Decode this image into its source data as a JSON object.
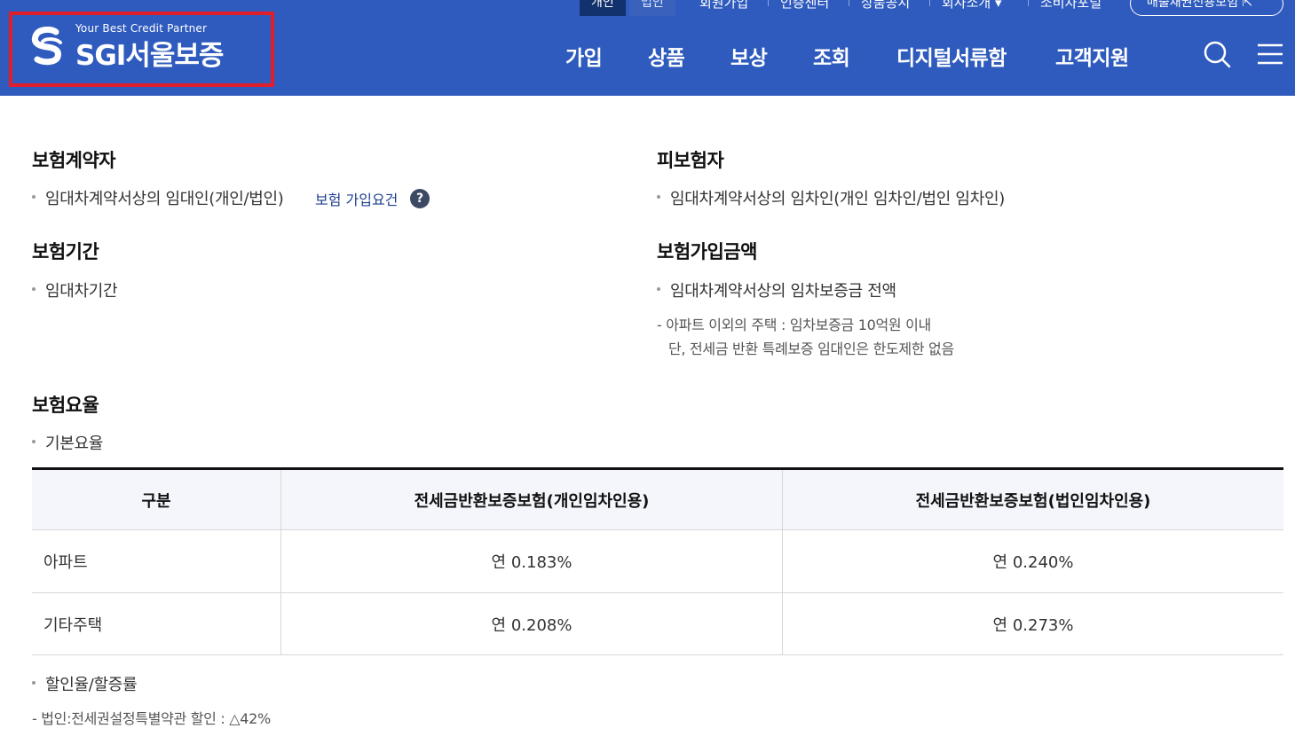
{
  "header": {
    "logo_tagline": "Your Best Credit Partner",
    "logo_text": "SGI서울보증",
    "util_tabs": [
      "개인",
      "법인"
    ],
    "util_links": [
      "회원가입",
      "인증센터",
      "상품공시",
      "회사소개 ▾",
      "소비자포털"
    ],
    "util_button": "매출채권신용보험 ⇱",
    "gnb": [
      "가입",
      "상품",
      "보상",
      "조회",
      "디지털서류함",
      "고객지원"
    ],
    "icons": [
      "search-icon",
      "menu-icon"
    ],
    "colors": {
      "bg": "#2f5bbe",
      "active_tab": "#12326d",
      "highlight_box": "#e01f2a"
    }
  },
  "policyholder": {
    "title": "보험계약자",
    "item": "임대차계약서상의 임대인(개인/법인)",
    "link": "보험 가입요건",
    "help": "?"
  },
  "insured": {
    "title": "피보험자",
    "item": "임대차계약서상의 임차인(개인 임차인/법인 임차인)"
  },
  "period": {
    "title": "보험기간",
    "item": "임대차기간"
  },
  "amount": {
    "title": "보험가입금액",
    "item": "임대차계약서상의 임차보증금 전액",
    "note1": "- 아파트 이외의 주택 : 임차보증금 10억원 이내",
    "note2": "단, 전세금 반환 특례보증 임대인은 한도제한 없음"
  },
  "rate": {
    "title": "보험요율",
    "basic": "기본요율",
    "table": {
      "headers": [
        "구분",
        "전세금반환보증보험(개인임차인용)",
        "전세금반환보증보험(법인임차인용)"
      ],
      "rows": [
        [
          "아파트",
          "연 0.183%",
          "연 0.240%"
        ],
        [
          "기타주택",
          "연 0.208%",
          "연 0.273%"
        ]
      ]
    },
    "discount": "할인율/할증률",
    "discount_note": "- 법인:전세권설정특별약관 할인 : △42%"
  }
}
